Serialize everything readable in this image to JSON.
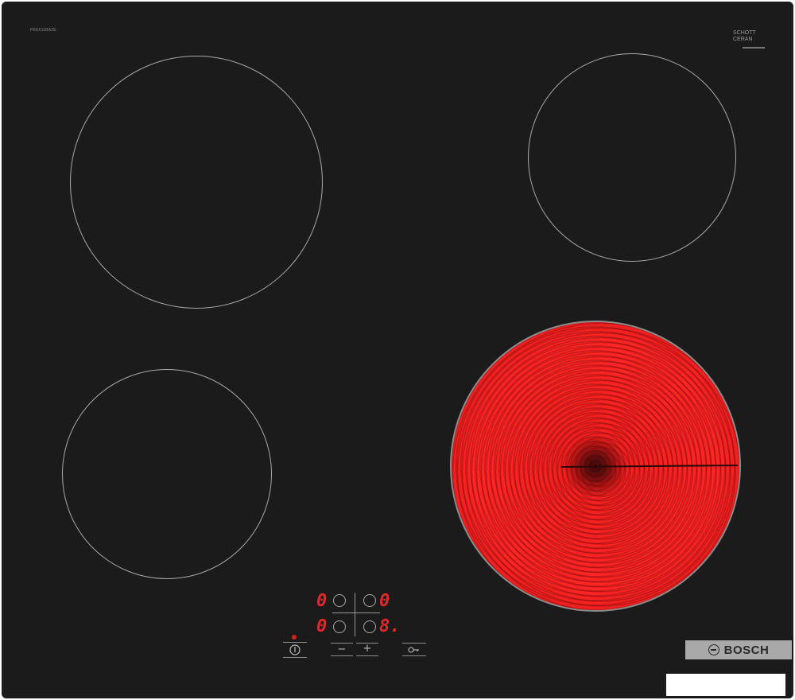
{
  "product": {
    "model_number": "PKE611BA2E",
    "glass_brand": "SCHOTT CERAN",
    "brand": "BOSCH",
    "brand_logo_icon": "bosch-logo-icon"
  },
  "zones": [
    {
      "id": "front-left-zone",
      "state": "off"
    },
    {
      "id": "rear-left-zone",
      "state": "off"
    },
    {
      "id": "rear-right-zone",
      "state": "off"
    },
    {
      "id": "front-right-zone",
      "state": "on"
    }
  ],
  "displays": {
    "top_left": "0",
    "top_right": "0",
    "bottom_left": "0",
    "bottom_right": "8."
  },
  "buttons": {
    "power_icon": "power-icon",
    "minus": "−",
    "plus": "+",
    "lock_icon": "key-icon",
    "lock_glyph": "⚷"
  },
  "colors": {
    "glass": "#1b1b1b",
    "hot_zone": "#ff2525",
    "display": "#e02a2a",
    "badge": "#a9a9a9"
  }
}
